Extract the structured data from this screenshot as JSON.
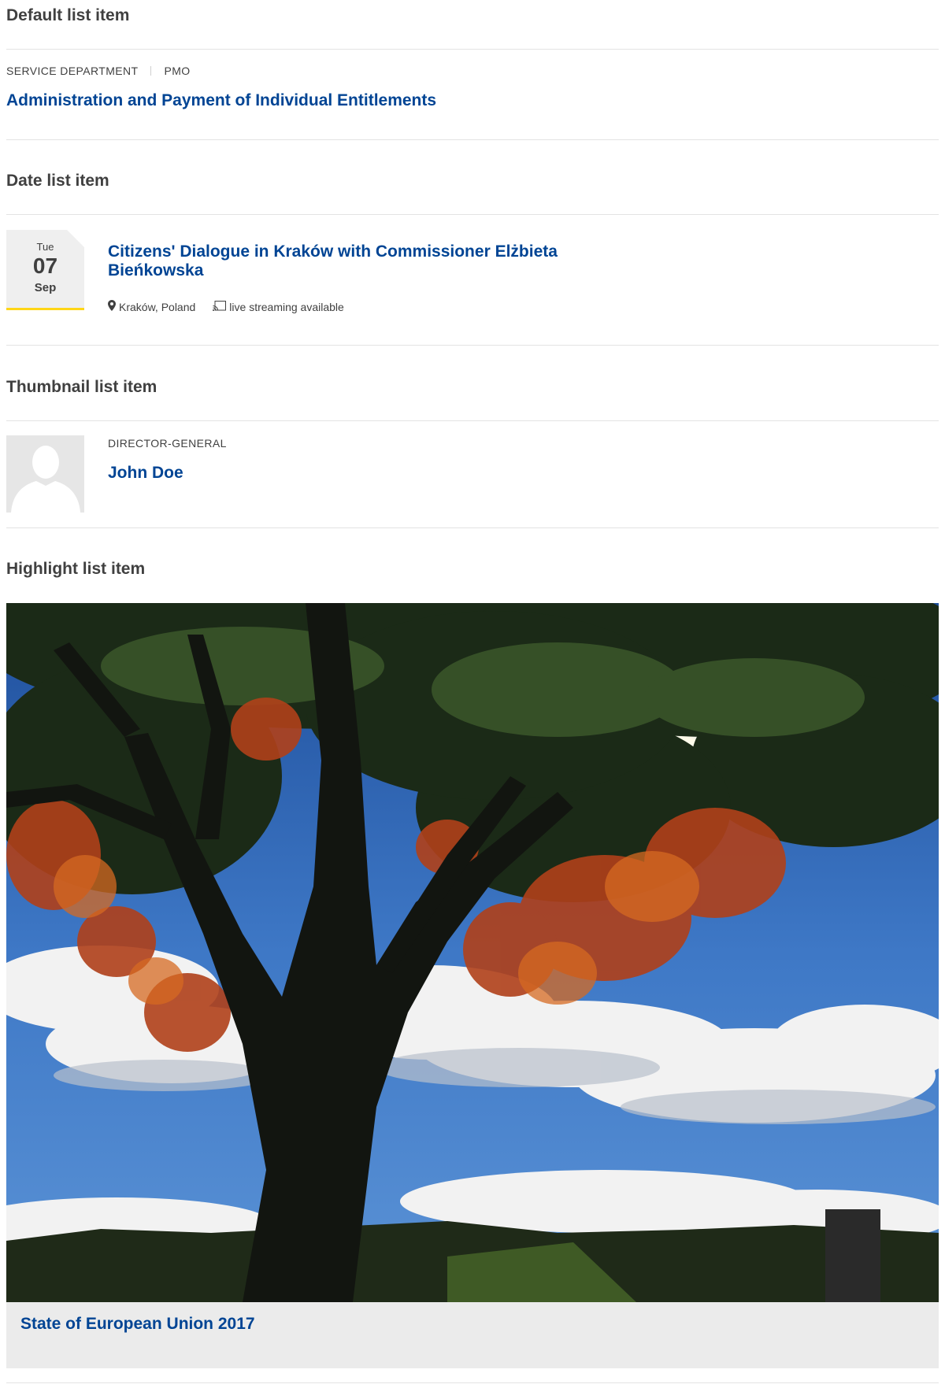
{
  "default_section": {
    "title": "Default list item",
    "meta": [
      "SERVICE DEPARTMENT",
      "PMO"
    ],
    "link": "Administration and Payment of Individual Entitlements"
  },
  "date_section": {
    "title": "Date list item",
    "date": {
      "weekday": "Tue",
      "day": "07",
      "month": "Sep"
    },
    "link_line1": "Citizens' Dialogue in Kraków with Commissioner Elżbieta",
    "link_line2": "Bieńkowska",
    "location": "Kraków, Poland",
    "streaming": "live streaming available",
    "location_icon": "map-marker-icon",
    "streaming_icon": "cast-icon"
  },
  "thumbnail_section": {
    "title": "Thumbnail list item",
    "meta": "DIRECTOR-GENERAL",
    "link": "John Doe",
    "avatar_icon": "person-silhouette-icon"
  },
  "highlight_section": {
    "title": "Highlight list item",
    "link": "State of European Union 2017",
    "image": "tree-sky-photo"
  },
  "colors": {
    "link": "#004494",
    "text": "#404040",
    "accent": "#ffd617",
    "rule": "#e3e3e3",
    "panel": "#ebebeb"
  }
}
